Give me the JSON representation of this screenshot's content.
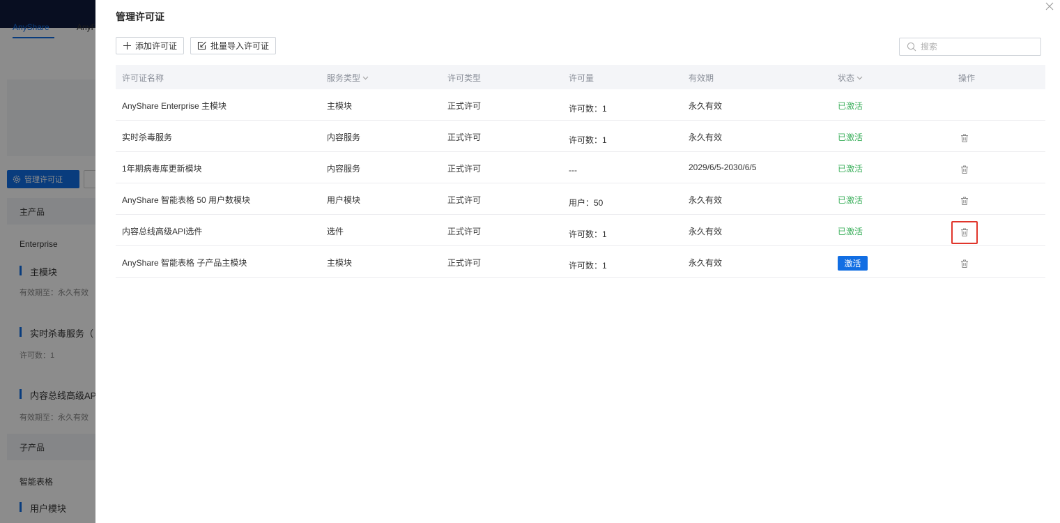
{
  "background_app": {
    "tabs": [
      "AnyShare",
      "AnyF"
    ],
    "manage_btn_label": "管理许可证",
    "sections": [
      {
        "title": "主产品"
      },
      {
        "title": "子产品"
      }
    ],
    "lines": {
      "enterprise": "Enterprise",
      "main_module": "主模块",
      "main_module_validity": "有效期至：永久有效",
      "antivirus": "实时杀毒服务（",
      "antivirus_count": "许可数：1",
      "api_addon": "内容总线高级AP",
      "api_validity": "有效期至：永久有效",
      "smart_table": "智能表格",
      "user_module": "用户模块"
    }
  },
  "drawer": {
    "title": "管理许可证",
    "add_btn": "添加许可证",
    "import_btn": "批量导入许可证",
    "search_placeholder": "搜索"
  },
  "table": {
    "columns": {
      "name": "许可证名称",
      "service_type": "服务类型",
      "license_type": "许可类型",
      "quantity": "许可量",
      "validity": "有效期",
      "status": "状态",
      "action": "操作"
    },
    "rows": [
      {
        "name": "AnyShare Enterprise 主模块",
        "service_type": "主模块",
        "license_type": "正式许可",
        "quantity": "许可数：1",
        "validity": "永久有效",
        "status": "已激活",
        "status_kind": "active",
        "deletable": false
      },
      {
        "name": "实时杀毒服务",
        "service_type": "内容服务",
        "license_type": "正式许可",
        "quantity": "许可数：1",
        "validity": "永久有效",
        "status": "已激活",
        "status_kind": "active",
        "deletable": true
      },
      {
        "name": "1年期病毒库更新模块",
        "service_type": "内容服务",
        "license_type": "正式许可",
        "quantity": "---",
        "validity": "2029/6/5-2030/6/5",
        "status": "已激活",
        "status_kind": "active",
        "deletable": true
      },
      {
        "name": "AnyShare 智能表格 50 用户数模块",
        "service_type": "用户模块",
        "license_type": "正式许可",
        "quantity": "用户：50",
        "validity": "永久有效",
        "status": "已激活",
        "status_kind": "active",
        "deletable": true
      },
      {
        "name": "内容总线高级API选件",
        "service_type": "选件",
        "license_type": "正式许可",
        "quantity": "许可数：1",
        "validity": "永久有效",
        "status": "已激活",
        "status_kind": "active",
        "deletable": true,
        "highlighted": true
      },
      {
        "name": "AnyShare 智能表格 子产品主模块",
        "service_type": "主模块",
        "license_type": "正式许可",
        "quantity": "许可数：1",
        "validity": "永久有效",
        "status": "激活",
        "status_kind": "button",
        "deletable": true
      }
    ]
  },
  "colors": {
    "accent": "#126ee3",
    "active_status": "#3db05d",
    "highlight": "#e0352b",
    "topbar": "#0f1b3d"
  }
}
